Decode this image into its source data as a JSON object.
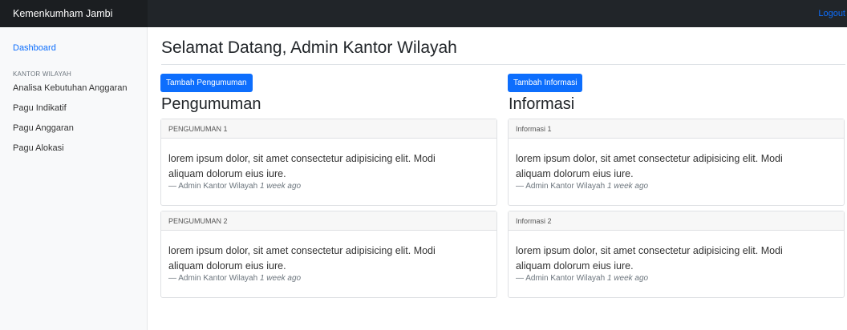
{
  "app": {
    "brand": "Kemenkumham Jambi",
    "logout": "Logout"
  },
  "sidebar": {
    "dashboard": "Dashboard",
    "section_heading": "KANTOR WILAYAH",
    "items": [
      {
        "label": "Analisa Kebutuhan Anggaran"
      },
      {
        "label": "Pagu Indikatif"
      },
      {
        "label": "Pagu Anggaran"
      },
      {
        "label": "Pagu Alokasi"
      }
    ]
  },
  "main": {
    "title": "Selamat Datang, Admin Kantor Wilayah",
    "pengumuman": {
      "button": "Tambah Pengumuman",
      "heading": "Pengumuman",
      "cards": [
        {
          "header": "PENGUMUMAN 1",
          "text": "lorem ipsum dolor, sit amet consectetur adipisicing elit. Modi aliquam dolorum eius iure.",
          "author": "— Admin Kantor Wilayah",
          "time": "1 week ago"
        },
        {
          "header": "PENGUMUMAN 2",
          "text": "lorem ipsum dolor, sit amet consectetur adipisicing elit. Modi aliquam dolorum eius iure.",
          "author": "— Admin Kantor Wilayah",
          "time": "1 week ago"
        }
      ]
    },
    "informasi": {
      "button": "Tambah Informasi",
      "heading": "Informasi",
      "cards": [
        {
          "header": "Informasi 1",
          "text": "lorem ipsum dolor, sit amet consectetur adipisicing elit. Modi aliquam dolorum eius iure.",
          "author": "— Admin Kantor Wilayah",
          "time": "1 week ago"
        },
        {
          "header": "Informasi 2",
          "text": "lorem ipsum dolor, sit amet consectetur adipisicing elit. Modi aliquam dolorum eius iure.",
          "author": "— Admin Kantor Wilayah",
          "time": "1 week ago"
        }
      ]
    }
  },
  "colors": {
    "primary": "#0d6efd",
    "navbar": "#212529",
    "sidebar": "#f8f9fa"
  }
}
